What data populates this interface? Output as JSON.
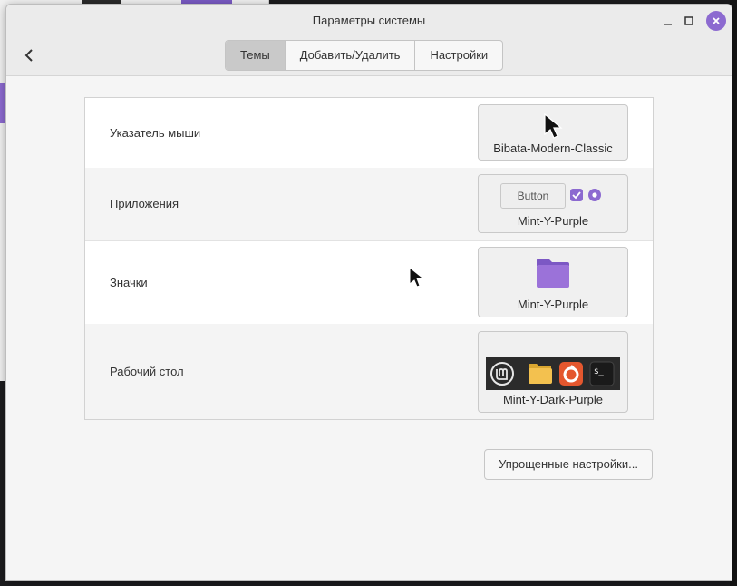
{
  "window": {
    "title": "Параметры системы"
  },
  "tabs": [
    {
      "label": "Темы",
      "active": true
    },
    {
      "label": "Добавить/Удалить",
      "active": false
    },
    {
      "label": "Настройки",
      "active": false
    }
  ],
  "rows": [
    {
      "label": "Указатель мыши",
      "theme": "Bibata-Modern-Classic"
    },
    {
      "label": "Приложения",
      "theme": "Mint-Y-Purple",
      "preview_button": "Button"
    },
    {
      "label": "Значки",
      "theme": "Mint-Y-Purple"
    },
    {
      "label": "Рабочий стол",
      "theme": "Mint-Y-Dark-Purple"
    }
  ],
  "simple_settings_button": "Упрощенные настройки...",
  "colors": {
    "accent": "#8c6ad0",
    "folder": "#9b72d9",
    "dark_strip": "#2b2b2b"
  },
  "icons": [
    "back-arrow-icon",
    "minimize-icon",
    "maximize-icon",
    "close-icon",
    "mouse-cursor-icon",
    "folder-icon",
    "mint-logo-icon",
    "files-icon",
    "firefox-icon",
    "terminal-icon"
  ]
}
